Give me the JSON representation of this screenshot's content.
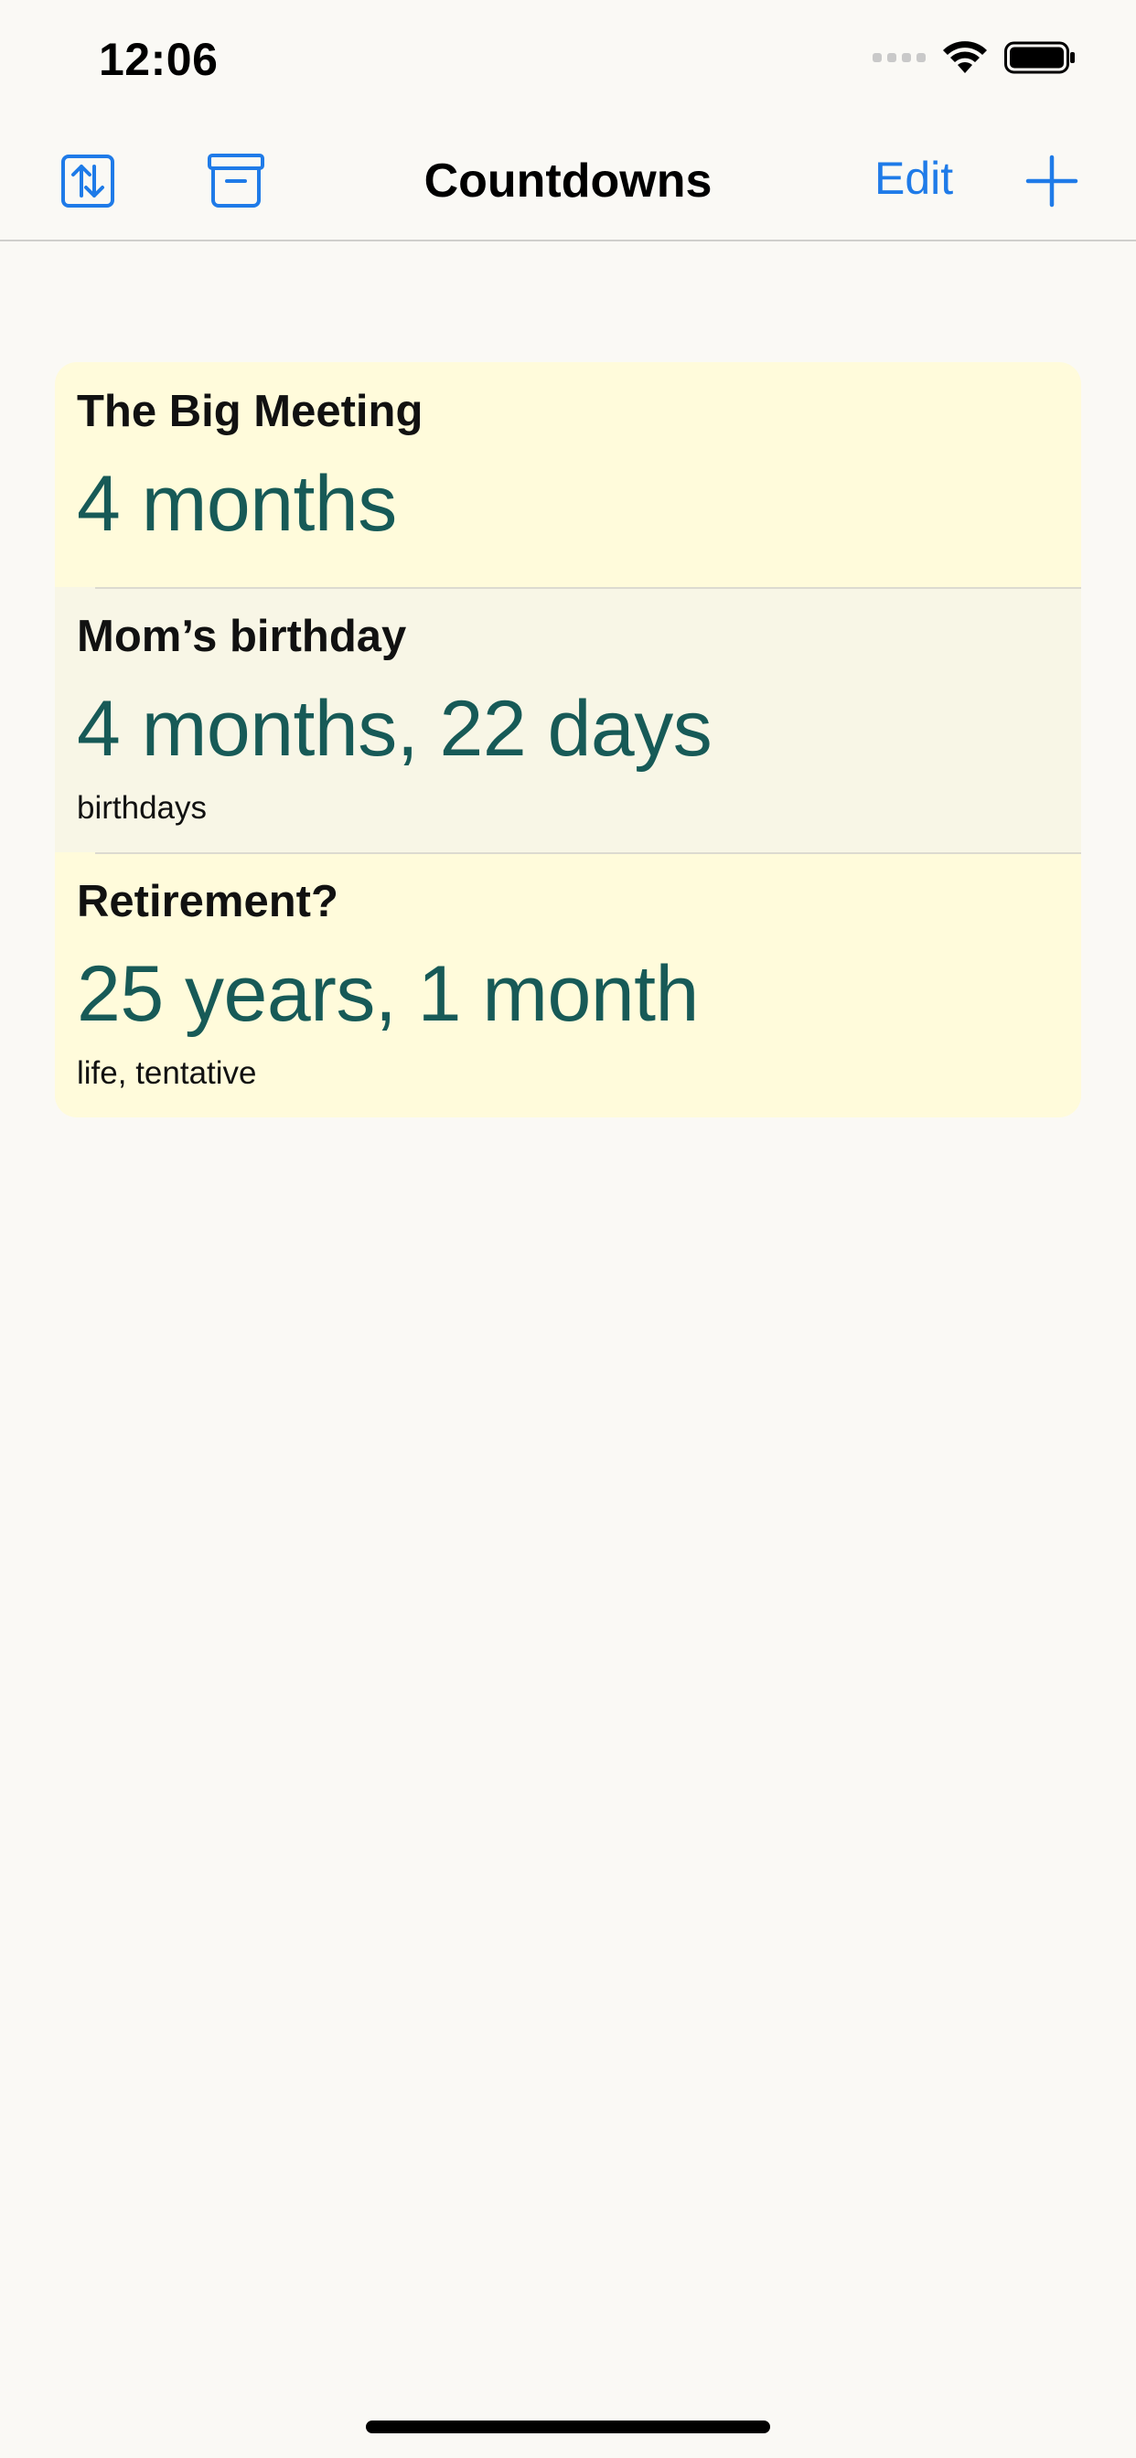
{
  "status_bar": {
    "time": "12:06",
    "icons": [
      "cellular-signal-icon",
      "wifi-icon",
      "battery-icon"
    ]
  },
  "nav": {
    "title": "Countdowns",
    "edit_label": "Edit",
    "icons": {
      "sort": "sort-arrows-icon",
      "archive": "archive-box-icon",
      "add": "plus-icon"
    }
  },
  "accent_color": "#1f7be8",
  "value_color": "#175a57",
  "countdowns": [
    {
      "title": "The Big Meeting",
      "value": "4 months",
      "tags": ""
    },
    {
      "title": "Mom’s birthday",
      "value": "4 months, 22 days",
      "tags": "birthdays"
    },
    {
      "title": "Retirement?",
      "value": "25 years, 1 month",
      "tags": "life, tentative"
    }
  ]
}
